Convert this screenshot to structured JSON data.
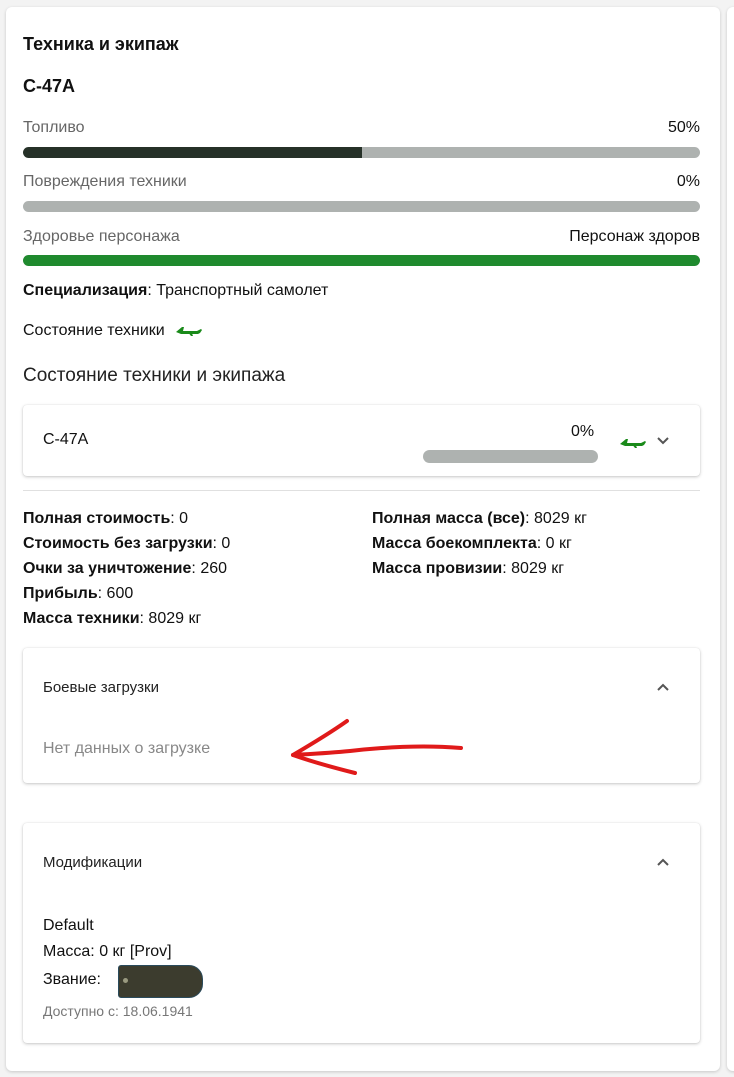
{
  "header": {
    "title": "Техника и экипаж",
    "vehicle_name": "C-47A"
  },
  "bars": {
    "fuel": {
      "label": "Топливо",
      "value_text": "50%",
      "value": 0.5,
      "color": "#263128"
    },
    "damage": {
      "label": "Повреждения техники",
      "value_text": "0%",
      "value": 0,
      "color": "#aeb2b0"
    },
    "health": {
      "label": "Здоровье персонажа",
      "value_text": "Персонаж здоров",
      "value": 1,
      "color": "#1f8a2e"
    }
  },
  "specialization": {
    "label": "Специализация",
    "value": ": Транспортный самолет"
  },
  "state": {
    "label": "Состояние техники",
    "icon": "plane-icon",
    "icon_color": "#1a8a1a"
  },
  "section_title": "Состояние техники и экипажа",
  "crew_panel": {
    "name": "C-47A",
    "percent": "0%",
    "progress": 0
  },
  "stats": {
    "left": [
      {
        "label": "Полная стоимость",
        "value": ": 0"
      },
      {
        "label": "Стоимость без загрузки",
        "value": ": 0"
      },
      {
        "label": "Очки за уничтожение",
        "value": ": 260"
      },
      {
        "label": "Прибыль",
        "value": ": 600"
      },
      {
        "label": "Масса техники",
        "value": ": 8029 кг"
      }
    ],
    "right": [
      {
        "label": "Полная масса (все)",
        "value": ": 8029 кг"
      },
      {
        "label": "Масса боекомплекта",
        "value": ": 0 кг"
      },
      {
        "label": "Масса провизии",
        "value": ": 8029 кг"
      }
    ]
  },
  "loadouts": {
    "title": "Боевые загрузки",
    "empty_text": "Нет данных о загрузке"
  },
  "modifications": {
    "title": "Модификации",
    "name": "Default",
    "mass": "Масса: 0 кг [Prov]",
    "rank_label": "Звание:",
    "available": "Доступно с: 18.06.1941"
  }
}
